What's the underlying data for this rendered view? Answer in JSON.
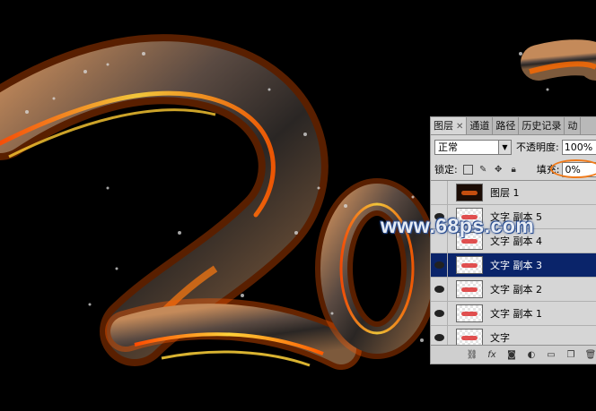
{
  "watermark": "www.68ps.com",
  "panel": {
    "tabs": [
      {
        "label": "图层",
        "active": true,
        "closable": true
      },
      {
        "label": "通道",
        "active": false
      },
      {
        "label": "路径",
        "active": false
      },
      {
        "label": "历史记录",
        "active": false
      },
      {
        "label": "动",
        "active": false
      }
    ],
    "blend_mode": "正常",
    "opacity_label": "不透明度:",
    "opacity_value": "100%",
    "lock_label": "锁定:",
    "fill_label": "填充:",
    "fill_value": "0%",
    "highlight_color": "#f07a1a",
    "selection_color": "#0a246a",
    "layers": [
      {
        "name": "图层 1",
        "visible": false,
        "selected": false,
        "thumb": "dark-artwork"
      },
      {
        "name": "文字 副本 5",
        "visible": true,
        "selected": false,
        "thumb": "transparent-text"
      },
      {
        "name": "文字 副本 4",
        "visible": false,
        "selected": false,
        "thumb": "transparent-text"
      },
      {
        "name": "文字 副本 3",
        "visible": true,
        "selected": true,
        "thumb": "transparent-text"
      },
      {
        "name": "文字 副本 2",
        "visible": true,
        "selected": false,
        "thumb": "transparent-text"
      },
      {
        "name": "文字 副本 1",
        "visible": true,
        "selected": false,
        "thumb": "transparent-text"
      },
      {
        "name": "文字",
        "visible": true,
        "selected": false,
        "thumb": "transparent-text"
      }
    ],
    "bottom_icons": [
      "link-icon",
      "fx-icon",
      "mask-icon",
      "adjustment-icon",
      "group-icon",
      "new-layer-icon",
      "trash-icon"
    ]
  }
}
